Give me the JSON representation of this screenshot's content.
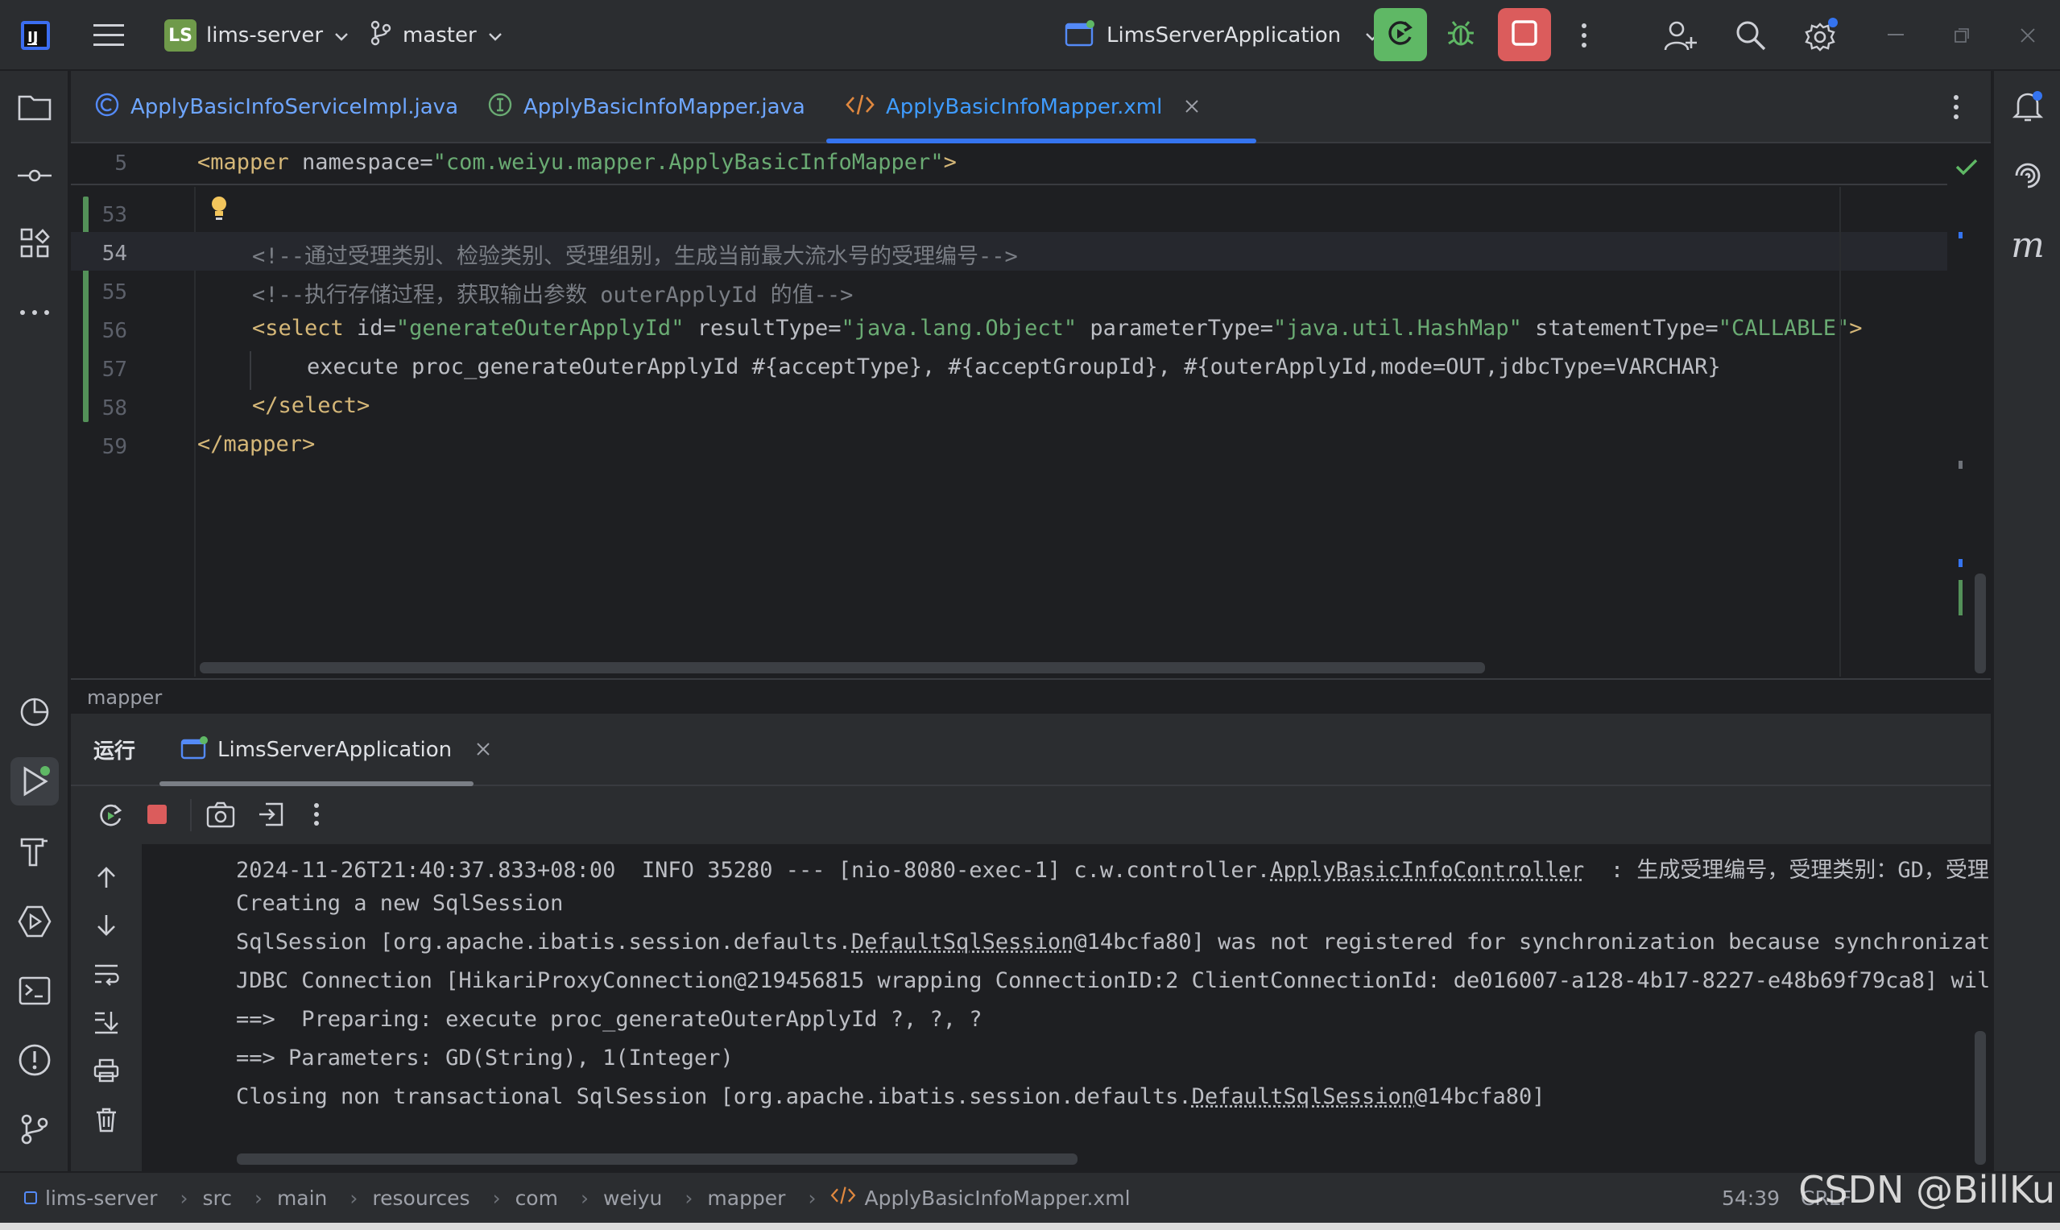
{
  "titlebar": {
    "project_badge": "LS",
    "project_name": "lims-server",
    "branch": "master",
    "run_config": "LimsServerApplication"
  },
  "editor_tabs": [
    {
      "label": "ApplyBasicInfoServiceImpl.java",
      "icon": "class-icon"
    },
    {
      "label": "ApplyBasicInfoMapper.java",
      "icon": "interface-icon"
    },
    {
      "label": "ApplyBasicInfoMapper.xml",
      "icon": "xml-icon",
      "active": true
    }
  ],
  "editor": {
    "sticky_line_number": "5",
    "sticky_line": {
      "tag_open": "<mapper ",
      "attr": "namespace=",
      "value": "\"com.weiyu.mapper.ApplyBasicInfoMapper\"",
      "tag_close": ">"
    },
    "lines": [
      {
        "num": "53"
      },
      {
        "num": "54",
        "comment": "<!--通过受理类别、检验类别、受理组别，生成当前最大流水号的受理编号-->"
      },
      {
        "num": "55",
        "comment": "<!--执行存储过程，获取输出参数 outerApplyId 的值-->"
      },
      {
        "num": "56",
        "tag": "<select ",
        "a1": "id=",
        "v1": "\"generateOuterApplyId\"",
        "a2": " resultType=",
        "v2": "\"java.lang.Object\"",
        "a3": " parameterType=",
        "v3": "\"java.util.HashMap\"",
        "a4": " statementType=",
        "v4": "\"CALLABLE\"",
        "close": ">"
      },
      {
        "num": "57",
        "text": "execute proc_generateOuterApplyId #{acceptType}, #{acceptGroupId}, #{outerApplyId,mode=OUT,jdbcType=VARCHAR}"
      },
      {
        "num": "58",
        "tag": "</select>"
      },
      {
        "num": "59",
        "tag": "</mapper>"
      }
    ]
  },
  "breadcrumb_label": "mapper",
  "run_panel": {
    "label": "运行",
    "tab": "LimsServerApplication",
    "console": [
      {
        "pre": "2024-11-26T21:40:37.833+08:00  INFO 35280 --- [nio-8080-exec-1] c.w.controller.",
        "u": "ApplyBasicInfoController",
        "post": "  : 生成受理编号，受理类别：GD，受理"
      },
      {
        "pre": "Creating a new SqlSession"
      },
      {
        "pre": "SqlSession [org.apache.ibatis.session.defaults.",
        "u": "DefaultSqlSession",
        "post": "@14bcfa80] was not registered for synchronization because synchronizat"
      },
      {
        "pre": "JDBC Connection [HikariProxyConnection@219456815 wrapping ConnectionID:2 ClientConnectionId: de016007-a128-4b17-8227-e48b69f79ca8] wil"
      },
      {
        "pre": "==>  Preparing: execute proc_generateOuterApplyId ?, ?, ?"
      },
      {
        "pre": "==> Parameters: GD(String), 1(Integer)"
      },
      {
        "pre": "Closing non transactional SqlSession [org.apache.ibatis.session.defaults.",
        "u": "DefaultSqlSession",
        "post": "@14bcfa80]"
      }
    ]
  },
  "statusbar": {
    "path": [
      "lims-server",
      "src",
      "main",
      "resources",
      "com",
      "weiyu",
      "mapper",
      "ApplyBasicInfoMapper.xml"
    ],
    "position": "54:39",
    "encoding": "CRLF"
  },
  "watermark": "CSDN @BillKu",
  "colors": {
    "accent": "#3574f0",
    "run_green": "#5fb865",
    "stop_red": "#db5c5c",
    "tag": "#d5b778",
    "string": "#6aab73",
    "comment": "#7a7e85"
  }
}
